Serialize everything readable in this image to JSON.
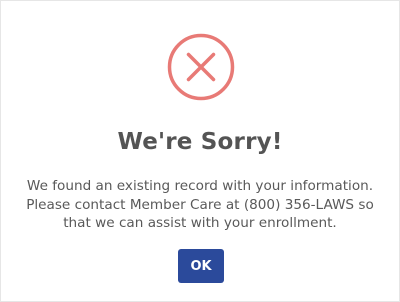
{
  "dialog": {
    "icon": "error-x-circle-icon",
    "icon_color": "#e87a76",
    "title": "We're Sorry!",
    "message_lines": [
      "We found an existing record with your information.",
      "Please contact Member Care at (800) 356-LAWS so",
      "that we can assist with your enrollment."
    ],
    "ok_label": "OK",
    "ok_color": "#2b4a9b"
  }
}
